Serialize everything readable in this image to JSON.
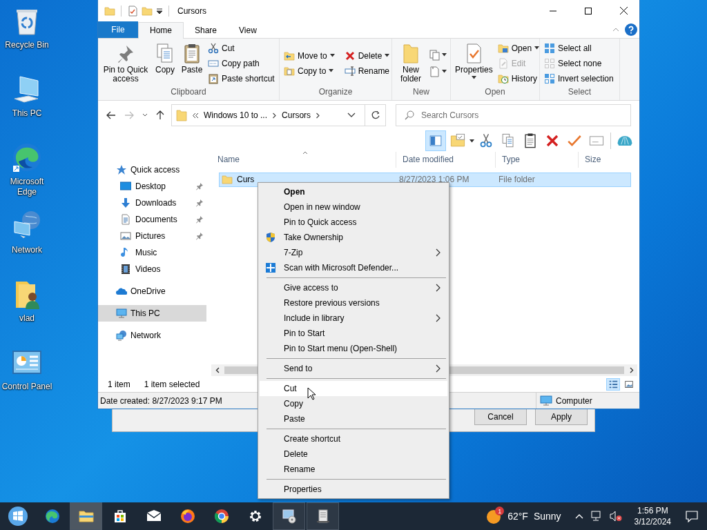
{
  "desktop_icons": [
    {
      "label": "Recycle Bin"
    },
    {
      "label": "This PC"
    },
    {
      "label": "Microsoft Edge"
    },
    {
      "label": "Network"
    },
    {
      "label": "vlad"
    },
    {
      "label": "Control Panel"
    }
  ],
  "explorer": {
    "title": "Cursors",
    "tabs": [
      {
        "label": "File",
        "kind": "menu",
        "selected": false
      },
      {
        "label": "Home",
        "kind": "tab",
        "selected": true
      },
      {
        "label": "Share",
        "kind": "tab",
        "selected": false
      },
      {
        "label": "View",
        "kind": "tab",
        "selected": false
      }
    ],
    "ribbon_groups": [
      {
        "label": "Clipboard",
        "commands": [
          {
            "label": "Pin to Quick access",
            "kind": "large",
            "dropdown": false,
            "disabled": false
          },
          {
            "label": "Copy",
            "kind": "large",
            "dropdown": false,
            "disabled": false
          },
          {
            "label": "Paste",
            "kind": "large",
            "dropdown": false,
            "disabled": false
          },
          {
            "label": "Cut",
            "kind": "small",
            "dropdown": false,
            "disabled": false
          },
          {
            "label": "Copy path",
            "kind": "small",
            "dropdown": false,
            "disabled": false
          },
          {
            "label": "Paste shortcut",
            "kind": "small",
            "dropdown": false,
            "disabled": false
          }
        ]
      },
      {
        "label": "Organize",
        "commands": [
          {
            "label": "Move to",
            "kind": "small",
            "dropdown": true,
            "disabled": false
          },
          {
            "label": "Copy to",
            "kind": "small",
            "dropdown": true,
            "disabled": false
          },
          {
            "label": "Delete",
            "kind": "small",
            "dropdown": true,
            "disabled": false
          },
          {
            "label": "Rename",
            "kind": "small",
            "dropdown": false,
            "disabled": false
          }
        ]
      },
      {
        "label": "New",
        "commands": [
          {
            "label": "New folder",
            "kind": "large",
            "dropdown": false,
            "disabled": false
          }
        ]
      },
      {
        "label": "Open",
        "commands": [
          {
            "label": "Properties",
            "kind": "large",
            "dropdown": true,
            "disabled": false
          },
          {
            "label": "Open",
            "kind": "small",
            "dropdown": true,
            "disabled": false
          },
          {
            "label": "Edit",
            "kind": "small",
            "dropdown": false,
            "disabled": true
          },
          {
            "label": "History",
            "kind": "small",
            "dropdown": false,
            "disabled": false
          }
        ]
      },
      {
        "label": "Select",
        "commands": [
          {
            "label": "Select all",
            "kind": "small",
            "dropdown": false,
            "disabled": false
          },
          {
            "label": "Select none",
            "kind": "small",
            "dropdown": false,
            "disabled": false
          },
          {
            "label": "Invert selection",
            "kind": "small",
            "dropdown": false,
            "disabled": false
          }
        ]
      }
    ],
    "address": {
      "crumbs": [
        "Windows 10 to ...",
        "Cursors"
      ]
    },
    "search": {
      "placeholder": "Search Cursors"
    },
    "toolbar": [
      {
        "selected": true
      },
      {
        "selected": false
      },
      {
        "selected": false
      },
      {
        "selected": false
      },
      {
        "selected": false
      },
      {
        "selected": false
      },
      {
        "selected": false
      },
      {
        "selected": false
      },
      {
        "selected": false
      }
    ],
    "nav": [
      {
        "label": "Quick access",
        "selected": false,
        "children": [
          {
            "label": "Desktop",
            "pinned": true,
            "selected": false
          },
          {
            "label": "Downloads",
            "pinned": true,
            "selected": false
          },
          {
            "label": "Documents",
            "pinned": true,
            "selected": false
          },
          {
            "label": "Pictures",
            "pinned": true,
            "selected": false
          },
          {
            "label": "Music",
            "pinned": false,
            "selected": false
          },
          {
            "label": "Videos",
            "pinned": false,
            "selected": false
          }
        ]
      },
      {
        "label": "OneDrive",
        "selected": false
      },
      {
        "label": "This PC",
        "selected": true
      },
      {
        "label": "Network",
        "selected": false
      }
    ],
    "columns": [
      "Name",
      "Date modified",
      "Type",
      "Size"
    ],
    "rows": [
      {
        "name": "Curs",
        "date_modified": "8/27/2023 1:06 PM",
        "type": "File folder",
        "selected": true
      }
    ],
    "status": {
      "items": "1 item",
      "selection": "1 item selected"
    },
    "view_buttons": [
      {
        "selected": true
      },
      {
        "selected": false
      }
    ],
    "details": {
      "info": "Date created: 8/27/2023 9:17 PM",
      "location": "Computer"
    }
  },
  "dialog": {
    "buttons": [
      "Cancel",
      "Apply"
    ]
  },
  "context_menu": {
    "sections": [
      {
        "items": [
          {
            "label": "Open",
            "bold": true,
            "submenu": false,
            "selected": false
          },
          {
            "label": "Open in new window",
            "bold": false,
            "submenu": false,
            "selected": false
          },
          {
            "label": "Pin to Quick access",
            "bold": false,
            "submenu": false,
            "selected": false
          },
          {
            "label": "Take Ownership",
            "bold": false,
            "submenu": false,
            "selected": false
          },
          {
            "label": "7-Zip",
            "bold": false,
            "submenu": true,
            "selected": false
          },
          {
            "label": "Scan with Microsoft Defender...",
            "bold": false,
            "submenu": false,
            "selected": false
          }
        ]
      },
      {
        "items": [
          {
            "label": "Give access to",
            "bold": false,
            "submenu": true,
            "selected": false
          },
          {
            "label": "Restore previous versions",
            "bold": false,
            "submenu": false,
            "selected": false
          },
          {
            "label": "Include in library",
            "bold": false,
            "submenu": true,
            "selected": false
          },
          {
            "label": "Pin to Start",
            "bold": false,
            "submenu": false,
            "selected": false
          },
          {
            "label": "Pin to Start menu (Open-Shell)",
            "bold": false,
            "submenu": false,
            "selected": false
          }
        ]
      },
      {
        "items": [
          {
            "label": "Send to",
            "bold": false,
            "submenu": true,
            "selected": false
          }
        ]
      },
      {
        "items": [
          {
            "label": "Cut",
            "bold": false,
            "submenu": false,
            "selected": true
          },
          {
            "label": "Copy",
            "bold": false,
            "submenu": false,
            "selected": false
          },
          {
            "label": "Paste",
            "bold": false,
            "submenu": false,
            "selected": false
          }
        ]
      },
      {
        "items": [
          {
            "label": "Create shortcut",
            "bold": false,
            "submenu": false,
            "selected": false
          },
          {
            "label": "Delete",
            "bold": false,
            "submenu": false,
            "selected": false
          },
          {
            "label": "Rename",
            "bold": false,
            "submenu": false,
            "selected": false
          }
        ]
      },
      {
        "items": [
          {
            "label": "Properties",
            "bold": false,
            "submenu": false,
            "selected": false
          }
        ]
      }
    ]
  },
  "taskbar": {
    "apps": [
      {
        "selected": false,
        "open": false
      },
      {
        "selected": true,
        "open": true
      },
      {
        "selected": false,
        "open": false
      },
      {
        "selected": false,
        "open": false
      },
      {
        "selected": false,
        "open": false
      },
      {
        "selected": false,
        "open": false
      },
      {
        "selected": false,
        "open": false
      },
      {
        "selected": false,
        "open": true
      },
      {
        "selected": false,
        "open": true
      }
    ],
    "weather": {
      "badge": "1",
      "temperature": "62°F",
      "condition": "Sunny"
    },
    "clock": {
      "time": "1:56 PM",
      "date": "3/12/2024"
    }
  }
}
